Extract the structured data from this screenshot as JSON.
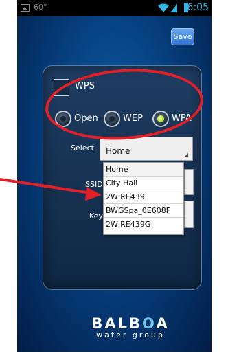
{
  "status_bar": {
    "temperature": "60°",
    "time": "6:05"
  },
  "toolbar": {
    "save_label": "Save"
  },
  "security": {
    "wps_label": "WPS",
    "options": [
      {
        "label": "Open",
        "selected": false
      },
      {
        "label": "WEP",
        "selected": false
      },
      {
        "label": "WPA",
        "selected": true
      }
    ]
  },
  "form": {
    "select_label": "Select",
    "select_value": "Home",
    "ssid_label": "SSID",
    "key_label": "Key"
  },
  "dropdown": {
    "items": [
      "Home",
      "City Hall",
      "2WIRE439",
      "BWGSpa_0E608F",
      "2WIRE439G"
    ]
  },
  "brand": {
    "name_prefix": "BAL",
    "name_o": "B",
    "name_suffix": "A",
    "tagline": "water group"
  },
  "colors": {
    "annotation": "#e3202a",
    "accent": "#33b5e5"
  }
}
